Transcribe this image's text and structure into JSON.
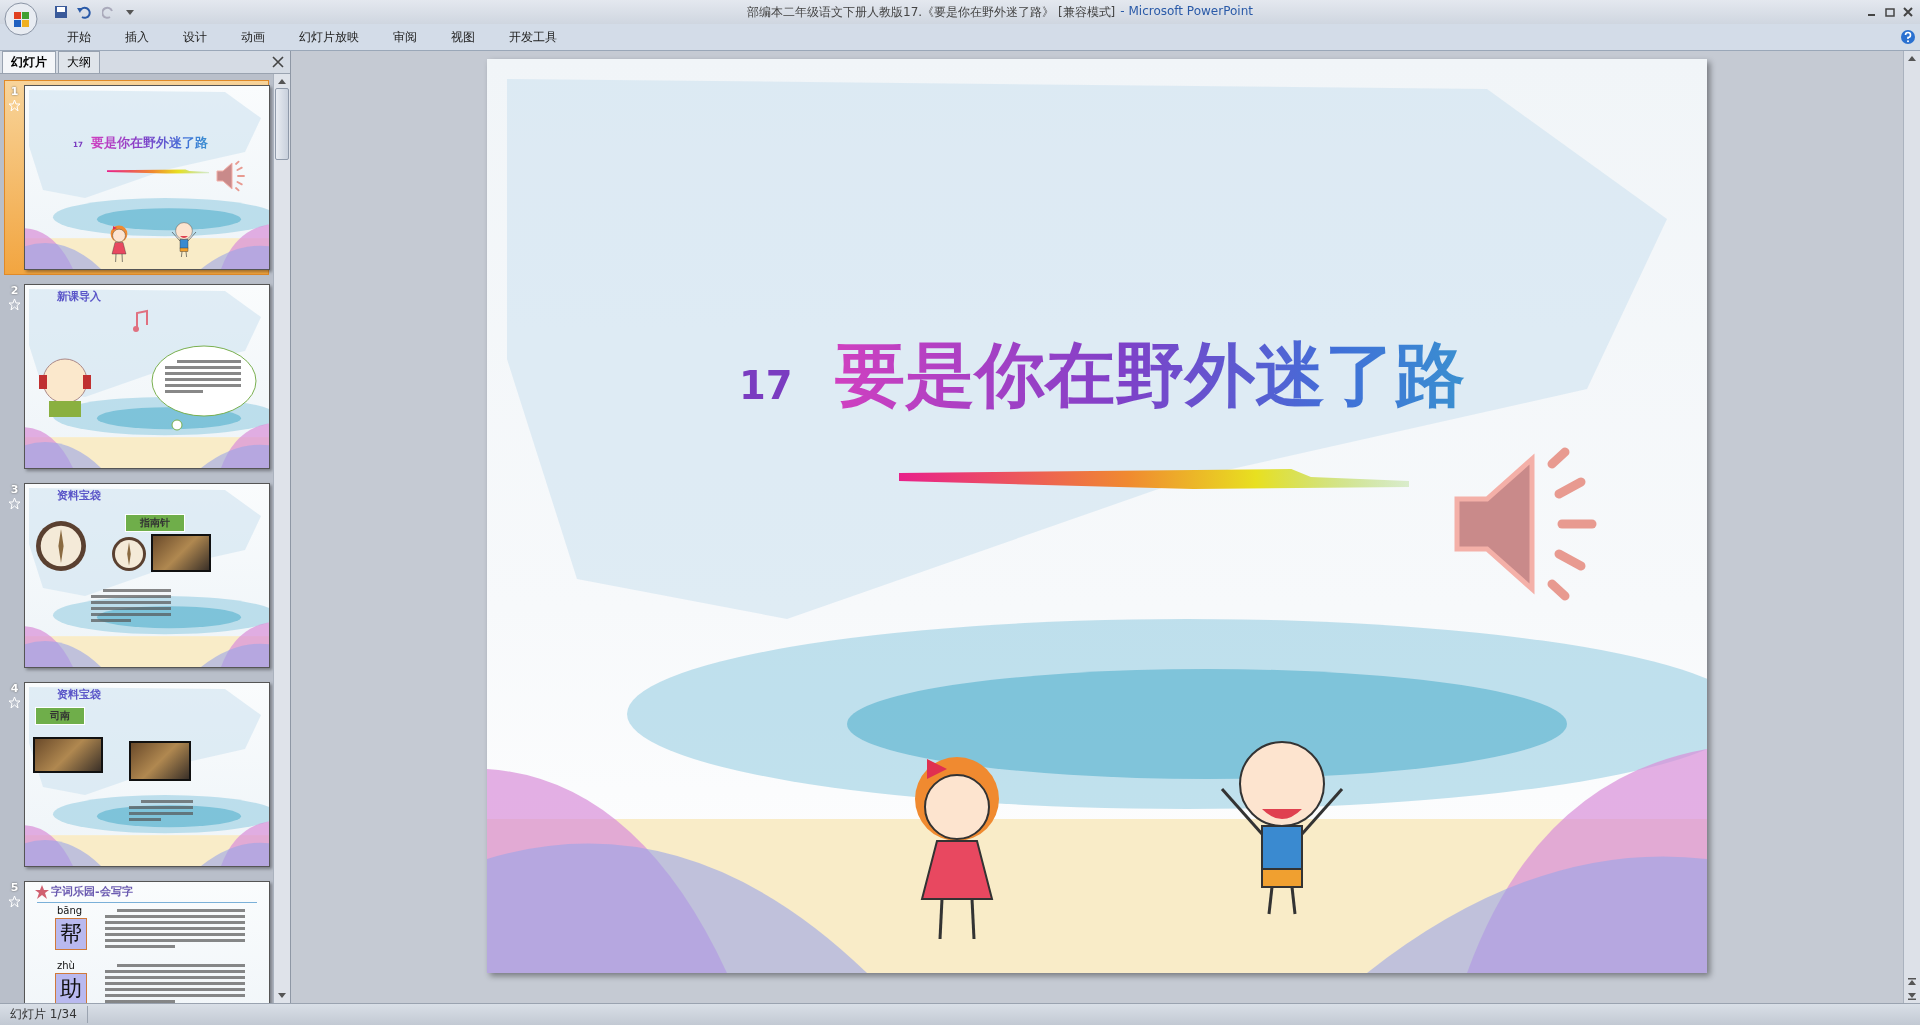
{
  "window": {
    "title": "部编本二年级语文下册人教版17.《要是你在野外迷了路》 [兼容模式]",
    "app": "- Microsoft PowerPoint"
  },
  "ribbon_tabs": [
    {
      "label": "开始",
      "selected": false
    },
    {
      "label": "插入",
      "selected": false
    },
    {
      "label": "设计",
      "selected": false
    },
    {
      "label": "动画",
      "selected": false
    },
    {
      "label": "幻灯片放映",
      "selected": false
    },
    {
      "label": "审阅",
      "selected": false
    },
    {
      "label": "视图",
      "selected": false
    },
    {
      "label": "开发工具",
      "selected": false
    }
  ],
  "pane_tabs": [
    {
      "label": "幻灯片",
      "selected": true
    },
    {
      "label": "大纲",
      "selected": false
    }
  ],
  "slides": [
    {
      "number": "1",
      "selected": true,
      "kind": "title",
      "title_number": "17",
      "title": "要是你在野外迷了路"
    },
    {
      "number": "2",
      "selected": false,
      "kind": "intro",
      "heading": "新课导入"
    },
    {
      "number": "3",
      "selected": false,
      "kind": "compass",
      "heading": "资料宝袋",
      "label": "指南针"
    },
    {
      "number": "4",
      "selected": false,
      "kind": "photos",
      "heading": "资料宝袋",
      "label": "司南"
    },
    {
      "number": "5",
      "selected": false,
      "kind": "chars",
      "heading": "字词乐园-会写字",
      "chars": [
        {
          "pinyin": "bāng",
          "char": "帮"
        },
        {
          "pinyin": "zhù",
          "char": "助"
        }
      ]
    }
  ],
  "current_slide": {
    "title_number": "17",
    "title": "要是你在野外迷了路"
  },
  "status_bar": {
    "slide_counter": "幻灯片 1/34"
  }
}
